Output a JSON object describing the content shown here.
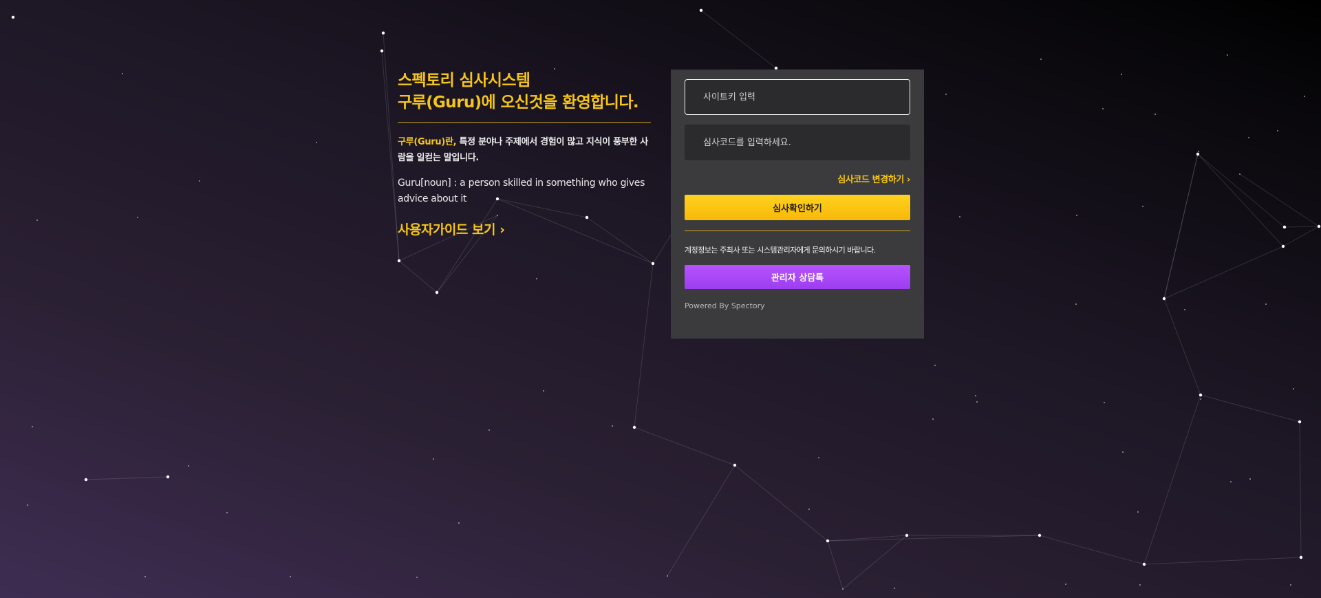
{
  "intro": {
    "title_line1": "스펙토리 심사시스템",
    "title_line2": "구루(Guru)에 오신것을 환영합니다.",
    "desc_highlight": "구루(Guru)란,",
    "desc_text": " 특정 분야나 주제에서 경험이 많고 지식이 풍부한 사람을 일컫는 말입니다.",
    "definition": "Guru[noun] : a person skilled in something who gives advice about it",
    "guide_link": "사용자가이드 보기 ›"
  },
  "login": {
    "sitekey_placeholder": "사이트키 입력",
    "code_placeholder": "심사코드를 입력하세요.",
    "change_code_link": "심사코드 변경하기 ›",
    "confirm_button": "심사확인하기",
    "notice": "계정정보는 주최사 또는 시스템관리자에게 문의하시기 바랍니다.",
    "chat_button": "관리자 상담톡",
    "powered_by": "Powered By Spectory"
  },
  "colors": {
    "accent_yellow": "#f5c518",
    "accent_purple": "#a847f7",
    "panel_bg": "#3b3a3c"
  }
}
